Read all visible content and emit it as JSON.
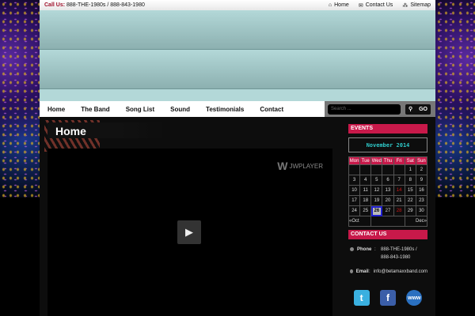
{
  "topbar": {
    "call_label": "Call Us:",
    "phone": "888-THE-1980s / 888-843-1980",
    "links": [
      {
        "icon": "home-icon",
        "label": "Home"
      },
      {
        "icon": "contact-icon",
        "label": "Contact Us"
      },
      {
        "icon": "sitemap-icon",
        "label": "Sitemap"
      }
    ]
  },
  "nav": {
    "items": [
      "Home",
      "The Band",
      "Song List",
      "Sound",
      "Testimonials",
      "Contact"
    ],
    "search_placeholder": "Search ...",
    "go_label": "GO"
  },
  "page": {
    "title": "Home",
    "player_brand": "JWPLAYER"
  },
  "events": {
    "heading": "EVENTS",
    "month": "November 2014",
    "weekdays": [
      "Mon",
      "Tue",
      "Wed",
      "Thu",
      "Fri",
      "Sat",
      "Sun"
    ],
    "weeks": [
      [
        "",
        "",
        "",
        "",
        "",
        "1",
        "2"
      ],
      [
        "3",
        "4",
        "5",
        "6",
        "7",
        "8",
        "9"
      ],
      [
        "10",
        "11",
        "12",
        "13",
        "14",
        "15",
        "16"
      ],
      [
        "17",
        "18",
        "19",
        "20",
        "21",
        "22",
        "23"
      ],
      [
        "24",
        "25",
        "26",
        "27",
        "28",
        "29",
        "30"
      ]
    ],
    "event_days": [
      "14",
      "28"
    ],
    "today": "26",
    "prev": "«Oct",
    "next": "Dec»"
  },
  "contact": {
    "heading": "CONTACT US",
    "phone_label": "Phone",
    "phone": "888-THE-1980s / 888-843-1980",
    "email_label": "Email",
    "email": "info@betamaxxband.com",
    "separator": ":"
  },
  "social": [
    {
      "name": "twitter",
      "glyph": "t",
      "color": "#3ab0e0"
    },
    {
      "name": "facebook",
      "glyph": "f",
      "color": "#3b5ea8"
    },
    {
      "name": "www",
      "glyph": "www",
      "color": "#2a70c0"
    }
  ]
}
